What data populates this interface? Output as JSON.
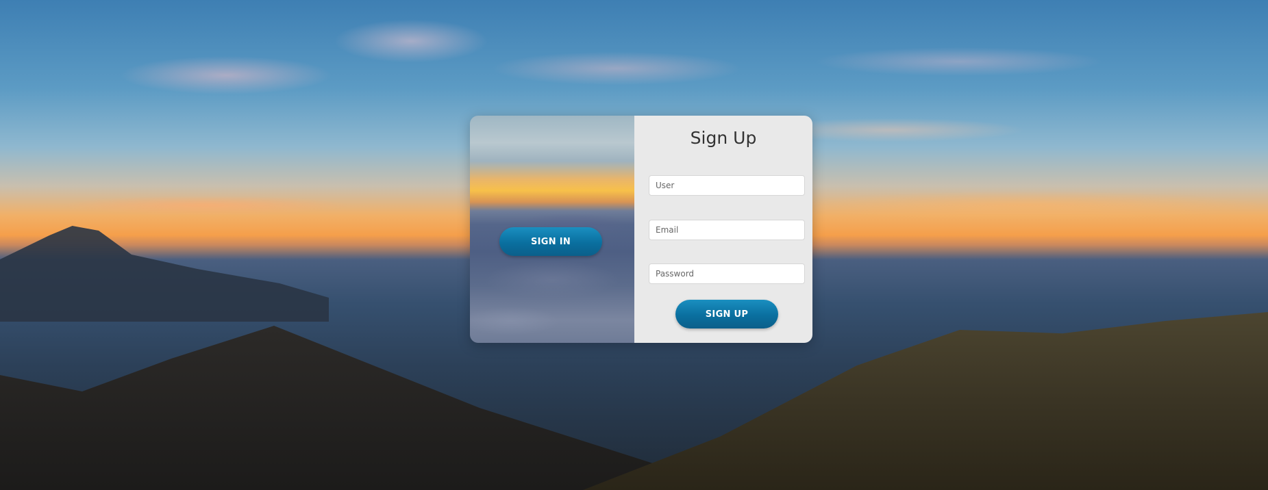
{
  "signin_panel": {
    "signin_label": "SIGN IN"
  },
  "signup_panel": {
    "title": "Sign Up",
    "user_placeholder": "User",
    "email_placeholder": "Email",
    "password_placeholder": "Password",
    "signup_label": "SIGN UP"
  },
  "colors": {
    "button_primary": "#0a6f9f",
    "panel_background": "#e9e9e9"
  }
}
